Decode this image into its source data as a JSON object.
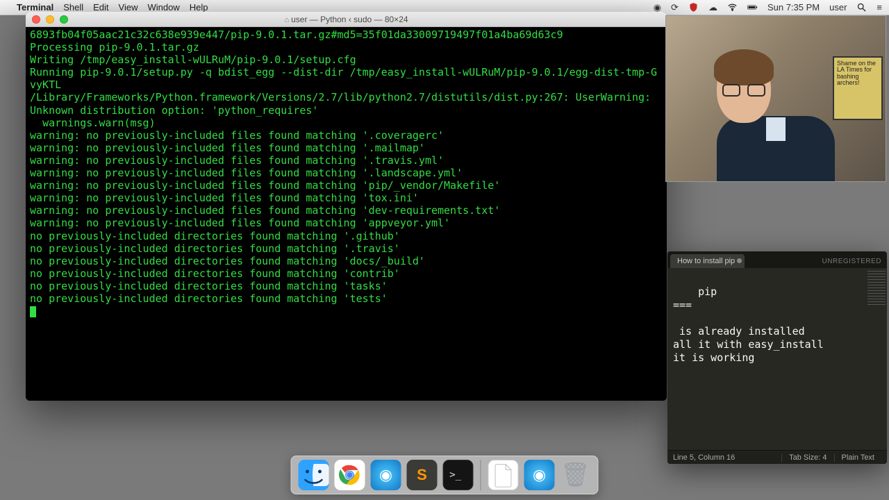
{
  "menubar": {
    "app": "Terminal",
    "items": [
      "Shell",
      "Edit",
      "View",
      "Window",
      "Help"
    ],
    "clock": "Sun 7:35 PM",
    "user": "user"
  },
  "terminal": {
    "title": "user — Python ‹ sudo — 80×24",
    "lines": [
      "6893fb04f05aac21c32c638e939e447/pip-9.0.1.tar.gz#md5=35f01da33009719497f01a4ba69d63c9",
      "Processing pip-9.0.1.tar.gz",
      "Writing /tmp/easy_install-wULRuM/pip-9.0.1/setup.cfg",
      "Running pip-9.0.1/setup.py -q bdist_egg --dist-dir /tmp/easy_install-wULRuM/pip-9.0.1/egg-dist-tmp-GvyKTL",
      "/Library/Frameworks/Python.framework/Versions/2.7/lib/python2.7/distutils/dist.py:267: UserWarning: Unknown distribution option: 'python_requires'",
      "  warnings.warn(msg)",
      "warning: no previously-included files found matching '.coveragerc'",
      "warning: no previously-included files found matching '.mailmap'",
      "warning: no previously-included files found matching '.travis.yml'",
      "warning: no previously-included files found matching '.landscape.yml'",
      "warning: no previously-included files found matching 'pip/_vendor/Makefile'",
      "warning: no previously-included files found matching 'tox.ini'",
      "warning: no previously-included files found matching 'dev-requirements.txt'",
      "warning: no previously-included files found matching 'appveyor.yml'",
      "no previously-included directories found matching '.github'",
      "no previously-included directories found matching '.travis'",
      "no previously-included directories found matching 'docs/_build'",
      "no previously-included directories found matching 'contrib'",
      "no previously-included directories found matching 'tasks'",
      "no previously-included directories found matching 'tests'"
    ]
  },
  "sublime": {
    "tab": "How to install pip",
    "unregistered": "UNREGISTERED",
    "content": "pip\n===\n\n is already installed\nall it with easy_install\nit is working",
    "status_left": "Line 5, Column 16",
    "status_tab": "Tab Size: 4",
    "status_syntax": "Plain Text"
  },
  "webcam": {
    "sign": "Shame on the LA Times for bashing archers!"
  },
  "dock": {
    "items": [
      "finder",
      "chrome",
      "app-circle",
      "sublime",
      "terminal",
      "doc",
      "app-circle-2",
      "trash"
    ]
  }
}
